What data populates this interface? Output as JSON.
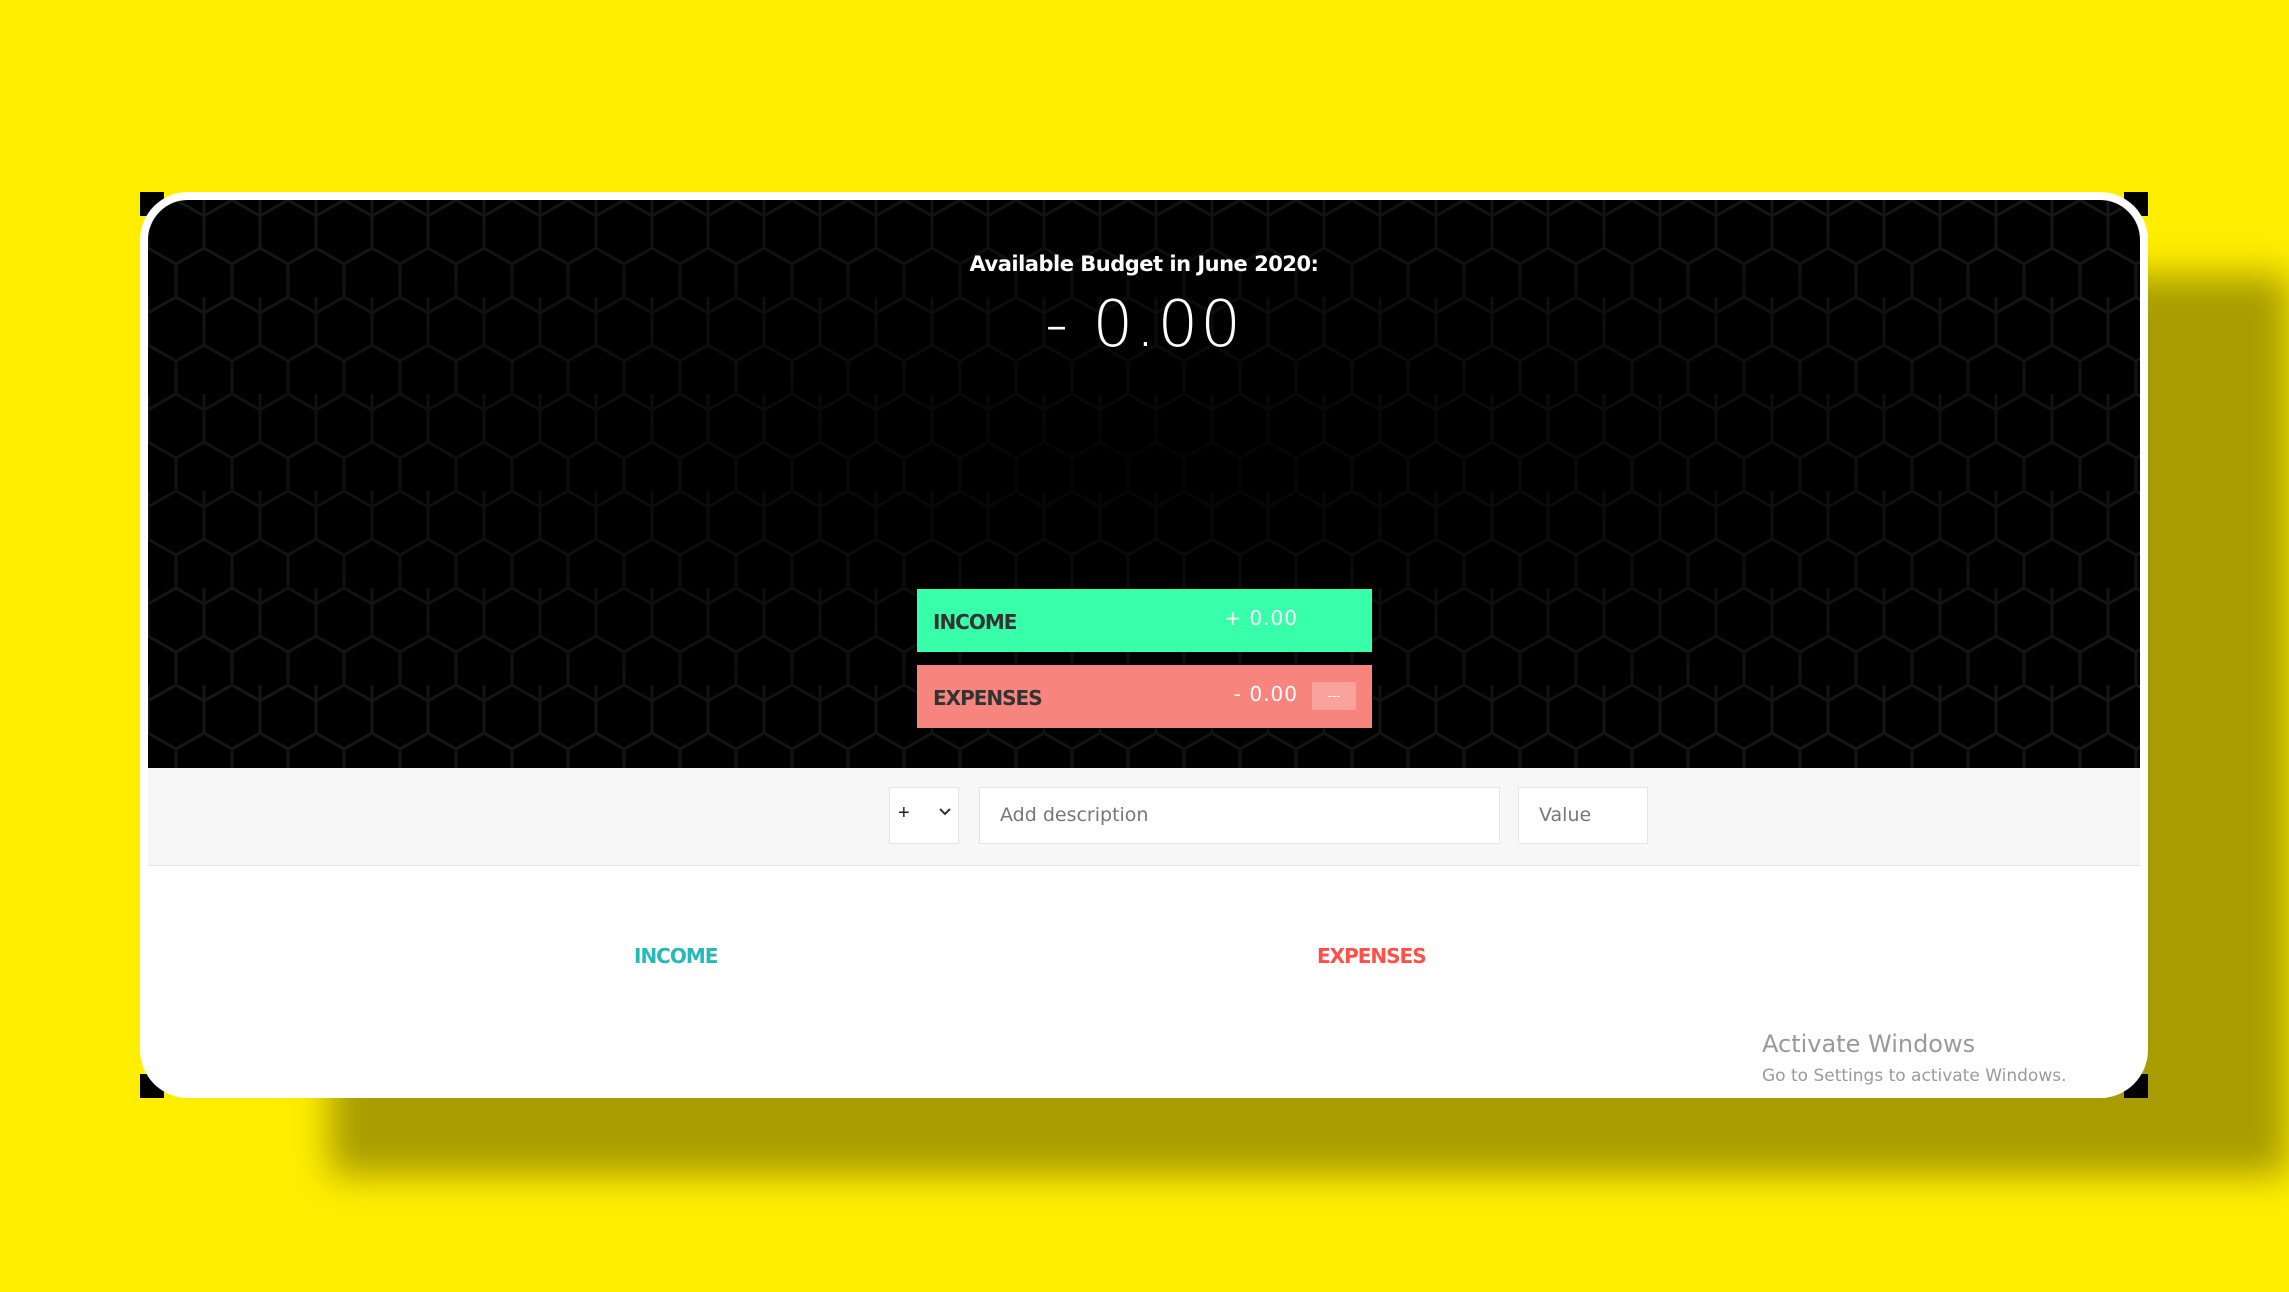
{
  "header": {
    "budget_title": "Available Budget in June 2020:",
    "budget_value": "- 0.00",
    "income": {
      "label": "INCOME",
      "value": "+ 0.00"
    },
    "expenses": {
      "label": "EXPENSES",
      "value": "- 0.00",
      "percentage": "---"
    }
  },
  "add_form": {
    "type_selected": "+",
    "description_placeholder": "Add description",
    "value_placeholder": "Value"
  },
  "lists": {
    "income_title": "INCOME",
    "expenses_title": "EXPENSES"
  },
  "watermark": {
    "line1": "Activate Windows",
    "line2": "Go to Settings to activate Windows."
  },
  "colors": {
    "background": "#ffee00",
    "income_bar": "#38ffaa",
    "expenses_bar": "#f8857d",
    "income_title": "#28b9b5",
    "expenses_title": "#ff5049"
  }
}
